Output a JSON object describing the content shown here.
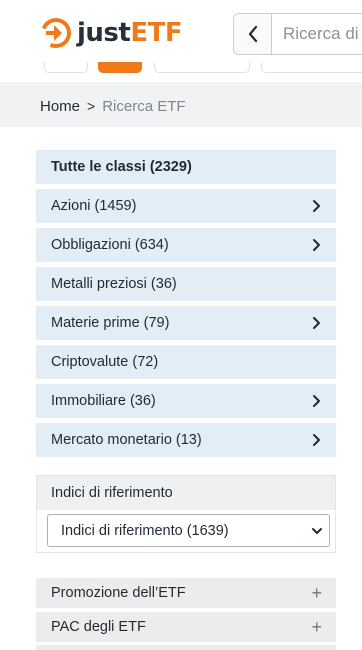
{
  "header": {
    "logo": {
      "just": "just",
      "etf": "ETF"
    },
    "search": {
      "placeholder": "Ricerca di"
    }
  },
  "breadcrumb": {
    "home": "Home",
    "separator": ">",
    "current": "Ricerca ETF"
  },
  "classes": [
    {
      "label": "Tutte le classi (2329)",
      "chevron": false
    },
    {
      "label": "Azioni (1459)",
      "chevron": true
    },
    {
      "label": "Obbligazioni (634)",
      "chevron": true
    },
    {
      "label": "Metalli preziosi (36)",
      "chevron": false
    },
    {
      "label": "Materie prime (79)",
      "chevron": true
    },
    {
      "label": "Criptovalute (72)",
      "chevron": false
    },
    {
      "label": "Immobiliare (36)",
      "chevron": true
    },
    {
      "label": "Mercato monetario (13)",
      "chevron": true
    }
  ],
  "indices": {
    "heading": "Indici di riferimento",
    "selected": "Indici di riferimento (1639)"
  },
  "accordions": [
    {
      "label": "Promozione dell’ETF",
      "icon": "+"
    },
    {
      "label": "PAC degli ETF",
      "icon": "+"
    }
  ],
  "colors": {
    "brand_orange": "#f07a1a",
    "brand_dark": "#25303b",
    "class_bg": "#e2edf6",
    "breadcrumb_bg": "#f1f2f3"
  }
}
